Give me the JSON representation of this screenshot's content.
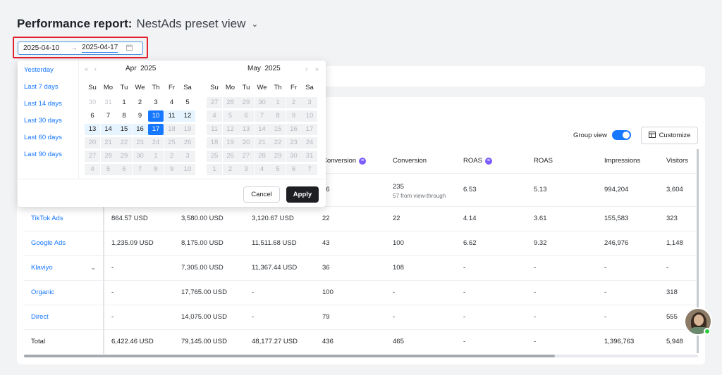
{
  "header": {
    "title": "Performance report:",
    "view_name": "NestAds preset view"
  },
  "date_range": {
    "start": "2025-04-10",
    "end": "2025-04-17",
    "arrow": "→"
  },
  "controls": {
    "group_view_label": "Group view",
    "group_view_on": true,
    "customize_label": "Customize"
  },
  "table": {
    "columns": [
      "",
      "",
      "",
      "",
      "Conversion",
      "Conversion",
      "ROAS",
      "ROAS",
      "Impressions",
      "Visitors"
    ],
    "rows": [
      {
        "name": "",
        "c1": "",
        "c2": "",
        "c3": "",
        "conv_a": "56",
        "conv_b": "235",
        "conv_b_note": "57 from view-through",
        "roas_a": "6.53",
        "roas_b": "5.13",
        "impressions": "994,204",
        "visitors": "3,604"
      },
      {
        "name": "TikTok Ads",
        "c1": "864.57 USD",
        "c2": "3,580.00 USD",
        "c3": "3,120.67 USD",
        "conv_a": "22",
        "conv_b": "22",
        "roas_a": "4.14",
        "roas_b": "3.61",
        "impressions": "155,583",
        "visitors": "323"
      },
      {
        "name": "Google Ads",
        "c1": "1,235.09 USD",
        "c2": "8,175.00 USD",
        "c3": "11,511.68 USD",
        "conv_a": "43",
        "conv_b": "100",
        "roas_a": "6.62",
        "roas_b": "9.32",
        "impressions": "246,976",
        "visitors": "1,148"
      },
      {
        "name": "Klaviyo",
        "c1": "-",
        "c2": "7,305.00 USD",
        "c3": "11,367.44 USD",
        "conv_a": "36",
        "conv_b": "108",
        "roas_a": "-",
        "roas_b": "-",
        "impressions": "-",
        "visitors": "-"
      },
      {
        "name": "Organic",
        "c1": "-",
        "c2": "17,765.00 USD",
        "c3": "-",
        "conv_a": "100",
        "conv_b": "-",
        "roas_a": "-",
        "roas_b": "-",
        "impressions": "-",
        "visitors": "318"
      },
      {
        "name": "Direct",
        "c1": "-",
        "c2": "14,075.00 USD",
        "c3": "-",
        "conv_a": "79",
        "conv_b": "-",
        "roas_a": "-",
        "roas_b": "-",
        "impressions": "-",
        "visitors": "555"
      },
      {
        "name": "Total",
        "c1": "6,422.46 USD",
        "c2": "79,145.00 USD",
        "c3": "48,177.27 USD",
        "conv_a": "436",
        "conv_b": "465",
        "roas_a": "-",
        "roas_b": "-",
        "impressions": "1,396,763",
        "visitors": "5,948"
      }
    ]
  },
  "picker": {
    "presets": [
      "Yesterday",
      "Last 7 days",
      "Last 14 days",
      "Last 30 days",
      "Last 60 days",
      "Last 90 days"
    ],
    "weekdays": [
      "Su",
      "Mo",
      "Tu",
      "We",
      "Th",
      "Fr",
      "Sa"
    ],
    "left": {
      "month": "Apr",
      "year": "2025",
      "nav_prev_year": "«",
      "nav_prev_month": "‹",
      "days": [
        [
          "30",
          "out"
        ],
        [
          "31",
          "out"
        ],
        [
          "1",
          "in"
        ],
        [
          "2",
          "in"
        ],
        [
          "3",
          "in"
        ],
        [
          "4",
          "in"
        ],
        [
          "5",
          "in"
        ],
        [
          "6",
          "in"
        ],
        [
          "7",
          "in"
        ],
        [
          "8",
          "in"
        ],
        [
          "9",
          "in"
        ],
        [
          "10",
          "sel"
        ],
        [
          "11",
          "range"
        ],
        [
          "12",
          "range"
        ],
        [
          "13",
          "range"
        ],
        [
          "14",
          "range"
        ],
        [
          "15",
          "range"
        ],
        [
          "16",
          "range"
        ],
        [
          "17",
          "sel"
        ],
        [
          "18",
          "dis"
        ],
        [
          "19",
          "dis"
        ],
        [
          "20",
          "dis"
        ],
        [
          "21",
          "dis"
        ],
        [
          "22",
          "dis"
        ],
        [
          "23",
          "dis"
        ],
        [
          "24",
          "dis"
        ],
        [
          "25",
          "dis"
        ],
        [
          "26",
          "dis"
        ],
        [
          "27",
          "dis"
        ],
        [
          "28",
          "dis"
        ],
        [
          "29",
          "dis"
        ],
        [
          "30",
          "dis"
        ],
        [
          "1",
          "dis"
        ],
        [
          "2",
          "dis"
        ],
        [
          "3",
          "dis"
        ],
        [
          "4",
          "dis"
        ],
        [
          "5",
          "dis"
        ],
        [
          "6",
          "dis"
        ],
        [
          "7",
          "dis"
        ],
        [
          "8",
          "dis"
        ],
        [
          "9",
          "dis"
        ],
        [
          "10",
          "dis"
        ]
      ]
    },
    "right": {
      "month": "May",
      "year": "2025",
      "nav_next_month": "›",
      "nav_next_year": "»",
      "days": [
        [
          "27",
          "dis"
        ],
        [
          "28",
          "dis"
        ],
        [
          "29",
          "dis"
        ],
        [
          "30",
          "dis"
        ],
        [
          "1",
          "dis"
        ],
        [
          "2",
          "dis"
        ],
        [
          "3",
          "dis"
        ],
        [
          "4",
          "dis"
        ],
        [
          "5",
          "dis"
        ],
        [
          "6",
          "dis"
        ],
        [
          "7",
          "dis"
        ],
        [
          "8",
          "dis"
        ],
        [
          "9",
          "dis"
        ],
        [
          "10",
          "dis"
        ],
        [
          "11",
          "dis"
        ],
        [
          "12",
          "dis"
        ],
        [
          "13",
          "dis"
        ],
        [
          "14",
          "dis"
        ],
        [
          "15",
          "dis"
        ],
        [
          "16",
          "dis"
        ],
        [
          "17",
          "dis"
        ],
        [
          "18",
          "dis"
        ],
        [
          "19",
          "dis"
        ],
        [
          "20",
          "dis"
        ],
        [
          "21",
          "dis"
        ],
        [
          "22",
          "dis"
        ],
        [
          "23",
          "dis"
        ],
        [
          "24",
          "dis"
        ],
        [
          "25",
          "dis"
        ],
        [
          "26",
          "dis"
        ],
        [
          "27",
          "dis"
        ],
        [
          "28",
          "dis"
        ],
        [
          "29",
          "dis"
        ],
        [
          "30",
          "dis"
        ],
        [
          "31",
          "dis"
        ],
        [
          "1",
          "dis"
        ],
        [
          "2",
          "dis"
        ],
        [
          "3",
          "dis"
        ],
        [
          "4",
          "dis"
        ],
        [
          "5",
          "dis"
        ],
        [
          "6",
          "dis"
        ],
        [
          "7",
          "dis"
        ]
      ]
    },
    "cancel_label": "Cancel",
    "apply_label": "Apply"
  }
}
